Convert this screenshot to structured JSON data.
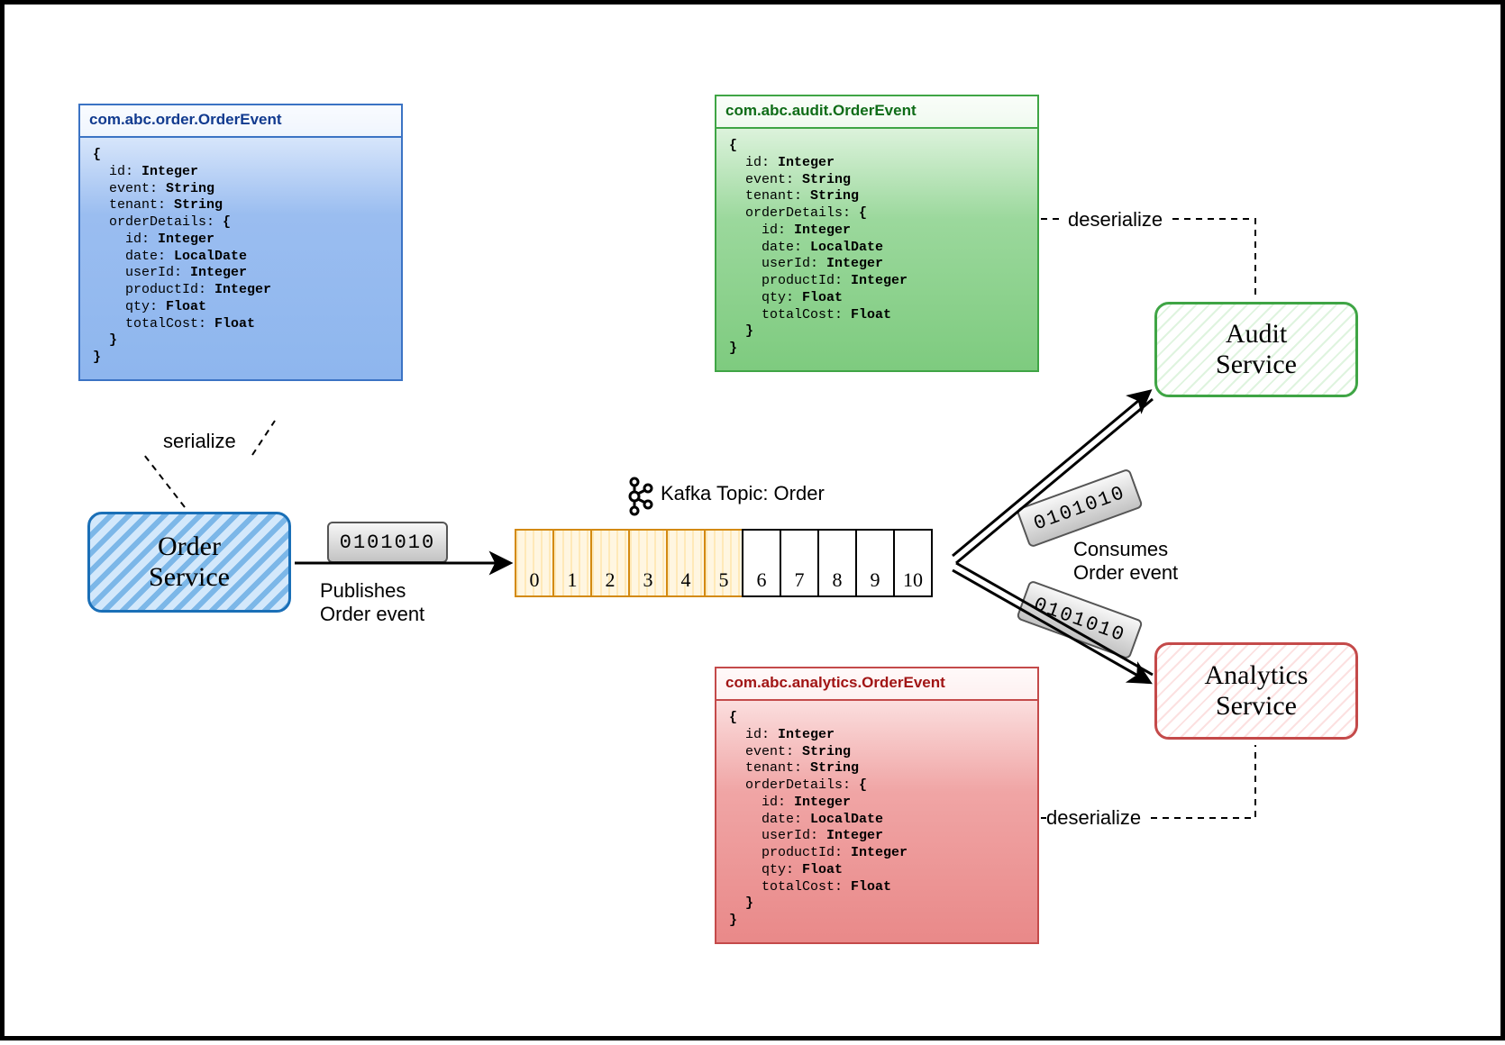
{
  "services": {
    "order": "Order\nService",
    "audit": "Audit\nService",
    "analytics": "Analytics\nService"
  },
  "schemas": {
    "blue": {
      "title": "com.abc.order.OrderEvent",
      "fields": [
        {
          "name": "id",
          "type": "Integer"
        },
        {
          "name": "event",
          "type": "String"
        },
        {
          "name": "tenant",
          "type": "String"
        },
        {
          "name": "orderDetails",
          "nested": [
            {
              "name": "id",
              "type": "Integer"
            },
            {
              "name": "date",
              "type": "LocalDate"
            },
            {
              "name": "userId",
              "type": "Integer"
            },
            {
              "name": "productId",
              "type": "Integer"
            },
            {
              "name": "qty",
              "type": "Float"
            },
            {
              "name": "totalCost",
              "type": "Float"
            }
          ]
        }
      ]
    },
    "green": {
      "title": "com.abc.audit.OrderEvent",
      "fields": [
        {
          "name": "id",
          "type": "Integer"
        },
        {
          "name": "event",
          "type": "String"
        },
        {
          "name": "tenant",
          "type": "String"
        },
        {
          "name": "orderDetails",
          "nested": [
            {
              "name": "id",
              "type": "Integer"
            },
            {
              "name": "date",
              "type": "LocalDate"
            },
            {
              "name": "userId",
              "type": "Integer"
            },
            {
              "name": "productId",
              "type": "Integer"
            },
            {
              "name": "qty",
              "type": "Float"
            },
            {
              "name": "totalCost",
              "type": "Float"
            }
          ]
        }
      ]
    },
    "red": {
      "title": "com.abc.analytics.OrderEvent",
      "fields": [
        {
          "name": "id",
          "type": "Integer"
        },
        {
          "name": "event",
          "type": "String"
        },
        {
          "name": "tenant",
          "type": "String"
        },
        {
          "name": "orderDetails",
          "nested": [
            {
              "name": "id",
              "type": "Integer"
            },
            {
              "name": "date",
              "type": "LocalDate"
            },
            {
              "name": "userId",
              "type": "Integer"
            },
            {
              "name": "productId",
              "type": "Integer"
            },
            {
              "name": "qty",
              "type": "Float"
            },
            {
              "name": "totalCost",
              "type": "Float"
            }
          ]
        }
      ]
    }
  },
  "topic": {
    "label": "Kafka Topic: Order",
    "partitions": [
      0,
      1,
      2,
      3,
      4,
      5,
      6,
      7,
      8,
      9,
      10
    ],
    "filledUpTo": 5
  },
  "packets": {
    "pub": "0101010",
    "toAudit": "0101010",
    "toAnalytics": "0101010"
  },
  "labels": {
    "serialize": "serialize",
    "deserializeTop": "deserialize",
    "deserializeBottom": "deserialize",
    "publishes": "Publishes\nOrder event",
    "consumes": "Consumes\nOrder event"
  }
}
